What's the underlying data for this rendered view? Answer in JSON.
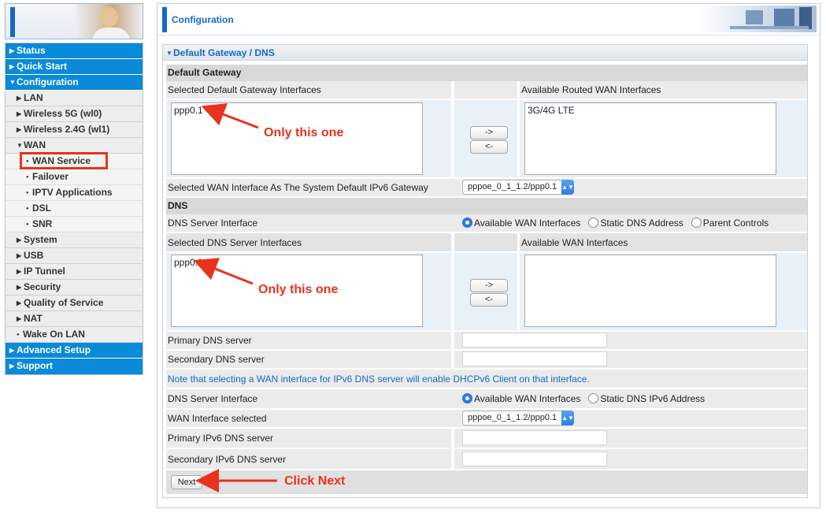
{
  "sidebar": {
    "items": [
      {
        "label": "Status",
        "level": 0,
        "expanded": false
      },
      {
        "label": "Quick Start",
        "level": 0,
        "expanded": false
      },
      {
        "label": "Configuration",
        "level": 0,
        "expanded": true
      },
      {
        "label": "LAN",
        "level": 1
      },
      {
        "label": "Wireless 5G (wl0)",
        "level": 1
      },
      {
        "label": "Wireless 2.4G (wl1)",
        "level": 1
      },
      {
        "label": "WAN",
        "level": 1,
        "expanded": true
      },
      {
        "label": "WAN Service",
        "level": 2,
        "highlighted": true
      },
      {
        "label": "Failover",
        "level": 2
      },
      {
        "label": "IPTV Applications",
        "level": 2
      },
      {
        "label": "DSL",
        "level": 2
      },
      {
        "label": "SNR",
        "level": 2
      },
      {
        "label": "System",
        "level": 1
      },
      {
        "label": "USB",
        "level": 1
      },
      {
        "label": "IP Tunnel",
        "level": 1
      },
      {
        "label": "Security",
        "level": 1
      },
      {
        "label": "Quality of Service",
        "level": 1
      },
      {
        "label": "NAT",
        "level": 1
      },
      {
        "label": "Wake On LAN",
        "level": 1
      },
      {
        "label": "Advanced Setup",
        "level": 0,
        "expanded": false
      },
      {
        "label": "Support",
        "level": 0,
        "expanded": false
      }
    ]
  },
  "header": {
    "title": "Configuration"
  },
  "panel": {
    "title": "Default Gateway / DNS",
    "default_gateway": {
      "section_label": "Default Gateway",
      "selected_header": "Selected Default Gateway Interfaces",
      "available_header": "Available Routed WAN Interfaces",
      "selected_items": [
        "ppp0.1"
      ],
      "available_items": [
        "3G/4G LTE"
      ],
      "move_right_label": "->",
      "move_left_label": "<-",
      "ipv6_gateway_label": "Selected WAN Interface As The System Default IPv6 Gateway",
      "ipv6_gateway_value": "pppoe_0_1_1.2/ppp0.1"
    },
    "dns": {
      "section_label": "DNS",
      "server_interface_label": "DNS Server Interface",
      "server_interface_options": [
        "Available WAN Interfaces",
        "Static DNS Address",
        "Parent Controls"
      ],
      "server_interface_selected": 0,
      "selected_header": "Selected DNS Server Interfaces",
      "available_header": "Available WAN Interfaces",
      "selected_items": [
        "ppp0.1"
      ],
      "available_items": [],
      "move_right_label": "->",
      "move_left_label": "<-",
      "primary_label": "Primary DNS server",
      "primary_value": "",
      "secondary_label": "Secondary DNS server",
      "secondary_value": "",
      "ipv6_note": "Note that selecting a WAN interface for IPv6 DNS server will enable DHCPv6 Client on that interface.",
      "ipv6_server_interface_label": "DNS Server Interface",
      "ipv6_server_interface_options": [
        "Available WAN Interfaces",
        "Static DNS IPv6 Address"
      ],
      "ipv6_server_interface_selected": 0,
      "wan_interface_label": "WAN Interface selected",
      "wan_interface_value": "pppoe_0_1_1.2/ppp0.1",
      "primary_ipv6_label": "Primary IPv6 DNS server",
      "primary_ipv6_value": "",
      "secondary_ipv6_label": "Secondary IPv6 DNS server",
      "secondary_ipv6_value": ""
    },
    "next_label": "Next"
  },
  "annotations": {
    "gateway_note": "Only this one",
    "dns_note": "Only this one",
    "next_note": "Click Next"
  },
  "colors": {
    "accent": "#0a8ad8",
    "annotation": "#e8321d",
    "link": "#1569c7"
  }
}
